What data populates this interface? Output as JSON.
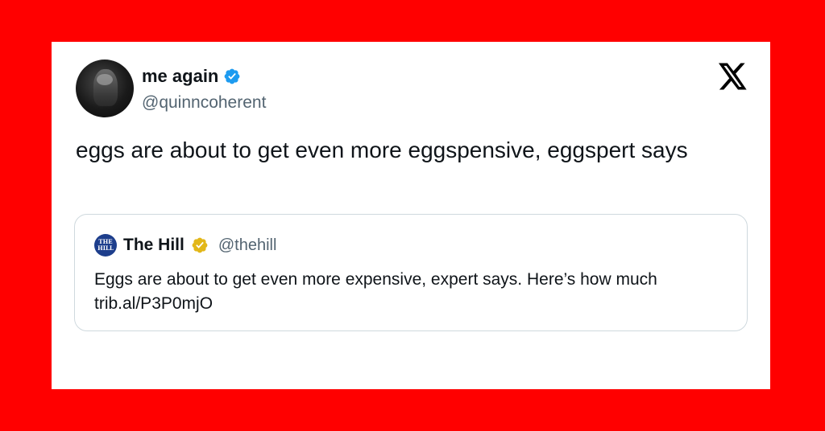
{
  "colors": {
    "background": "#ff0000",
    "card": "#ffffff",
    "verified_blue": "#1d9bf0",
    "verified_gold": "#e2b719",
    "text": "#0f1419",
    "muted": "#536471"
  },
  "author": {
    "name": "me again",
    "handle": "@quinncoherent",
    "badge_icon": "verified-blue-badge-icon"
  },
  "platform": {
    "logo_icon": "x-logo-icon"
  },
  "tweet": {
    "text": "eggs are about to get even more eggspensive, eggspert says"
  },
  "quoted_tweet": {
    "logo_icon": "the-hill-logo-icon",
    "logo_text_top": "THE",
    "logo_text_bottom": "HILL",
    "name": "The Hill",
    "badge_icon": "verified-gold-badge-icon",
    "handle": "@thehill",
    "text": "Eggs are about to get even more expensive, expert says. Here’s how much",
    "link": "trib.al/P3P0mjO"
  }
}
